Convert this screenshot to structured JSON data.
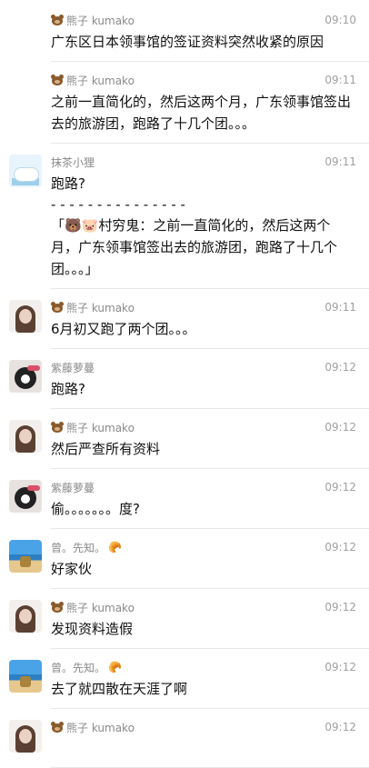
{
  "messages": [
    {
      "avatar": "none",
      "name": "熊子 kumako",
      "name_icon": "bear-icon",
      "time": "09:10",
      "text": "广东区日本领事馆的签证资料突然收紧的原因"
    },
    {
      "avatar": "none",
      "name": "熊子 kumako",
      "name_icon": "bear-icon",
      "time": "09:11",
      "text": "之前一直简化的，然后这两个月，广东领事馆签出去的旅游团，跑路了十几个团。。。"
    },
    {
      "avatar": "cloud-avatar",
      "name": "抹茶小狸",
      "time": "09:11",
      "text": "跑路?",
      "divider": "- - - - - - - - - - - - - - -",
      "quote": "「🐻🐷村穷鬼：之前一直简化的，然后这两个月，广东领事馆签出去的旅游团，跑路了十几个团。。。」"
    },
    {
      "avatar": "girl-avatar",
      "name": "熊子 kumako",
      "name_icon": "bear-icon",
      "time": "09:11",
      "text": "6月初又跑了两个团。。。"
    },
    {
      "avatar": "cat-avatar",
      "name": "紫藤萝蔓",
      "time": "09:12",
      "text": "跑路?"
    },
    {
      "avatar": "girl-avatar",
      "name": "熊子 kumako",
      "name_icon": "bear-icon",
      "time": "09:12",
      "text": "然后严查所有资料"
    },
    {
      "avatar": "cat-avatar",
      "name": "紫藤萝蔓",
      "time": "09:12",
      "text": "偷。。。。。。。度?"
    },
    {
      "avatar": "beach-avatar",
      "name": "曾。先知。",
      "name_suffix": "🥐",
      "time": "09:12",
      "text": "好家伙"
    },
    {
      "avatar": "girl-avatar",
      "name": "熊子 kumako",
      "name_icon": "bear-icon",
      "time": "09:12",
      "text": "发现资料造假"
    },
    {
      "avatar": "beach-avatar",
      "name": "曾。先知。",
      "name_suffix": "🥐",
      "time": "09:12",
      "text": "去了就四散在天涯了啊"
    },
    {
      "avatar": "girl-avatar",
      "name": "熊子 kumako",
      "name_icon": "bear-icon",
      "time": "09:12",
      "text": ""
    }
  ]
}
